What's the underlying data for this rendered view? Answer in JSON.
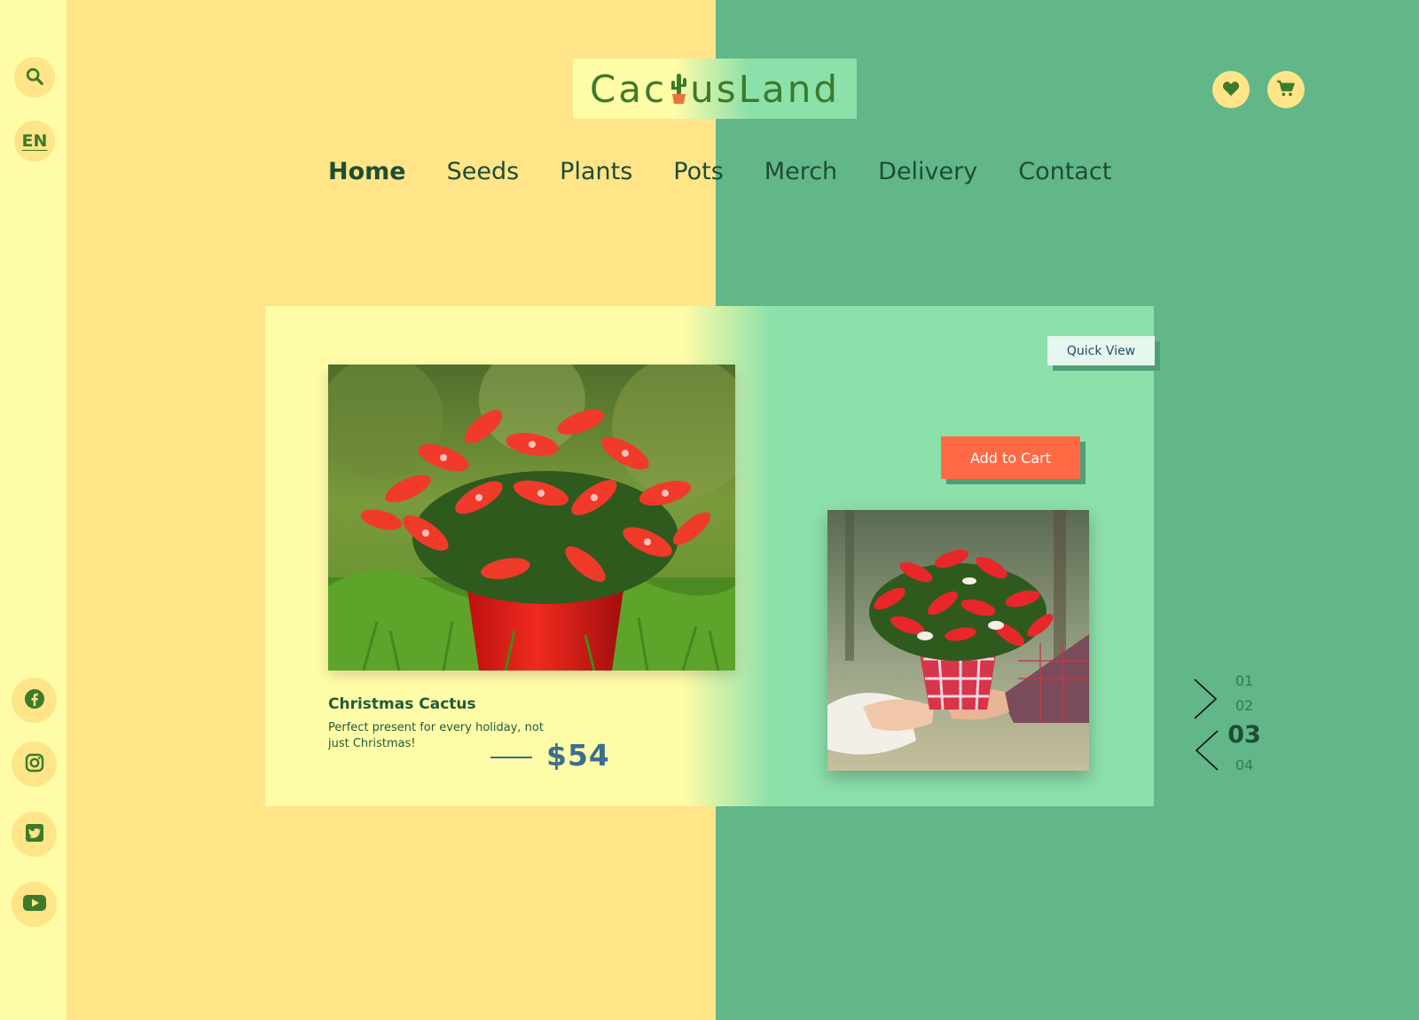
{
  "brand": {
    "logo_text_before": "Cac",
    "logo_text_after": "usLand",
    "logo_colors": {
      "bg_left": "#fffca8",
      "bg_right": "#8ce0aa",
      "text": "#3d7a2b"
    }
  },
  "sidebar": {
    "search_icon": "search-icon",
    "language": "EN",
    "social": [
      {
        "icon": "facebook-icon"
      },
      {
        "icon": "instagram-icon"
      },
      {
        "icon": "twitter-icon"
      },
      {
        "icon": "youtube-icon"
      }
    ]
  },
  "header": {
    "icons": [
      {
        "icon": "heart-icon"
      },
      {
        "icon": "cart-icon"
      }
    ]
  },
  "nav": {
    "items": [
      {
        "label": "Home",
        "active": true
      },
      {
        "label": "Seeds"
      },
      {
        "label": "Plants"
      },
      {
        "label": "Pots"
      },
      {
        "label": "Merch"
      },
      {
        "label": "Delivery"
      },
      {
        "label": "Contact"
      }
    ]
  },
  "product": {
    "name": "Christmas Cactus",
    "description": "Perfect present for every holiday, not just Christmas!",
    "price": "$54",
    "quick_view_label": "Quick View",
    "add_to_cart_label": "Add to Cart"
  },
  "pager": {
    "items": [
      "01",
      "02",
      "03",
      "04"
    ],
    "active": "03"
  },
  "colors": {
    "yellow": "#ffe488",
    "pale_yellow": "#fffca8",
    "green": "#62b788",
    "mint": "#8ce0aa",
    "accent": "#ff6a45",
    "dark_green": "#1f4d33"
  }
}
